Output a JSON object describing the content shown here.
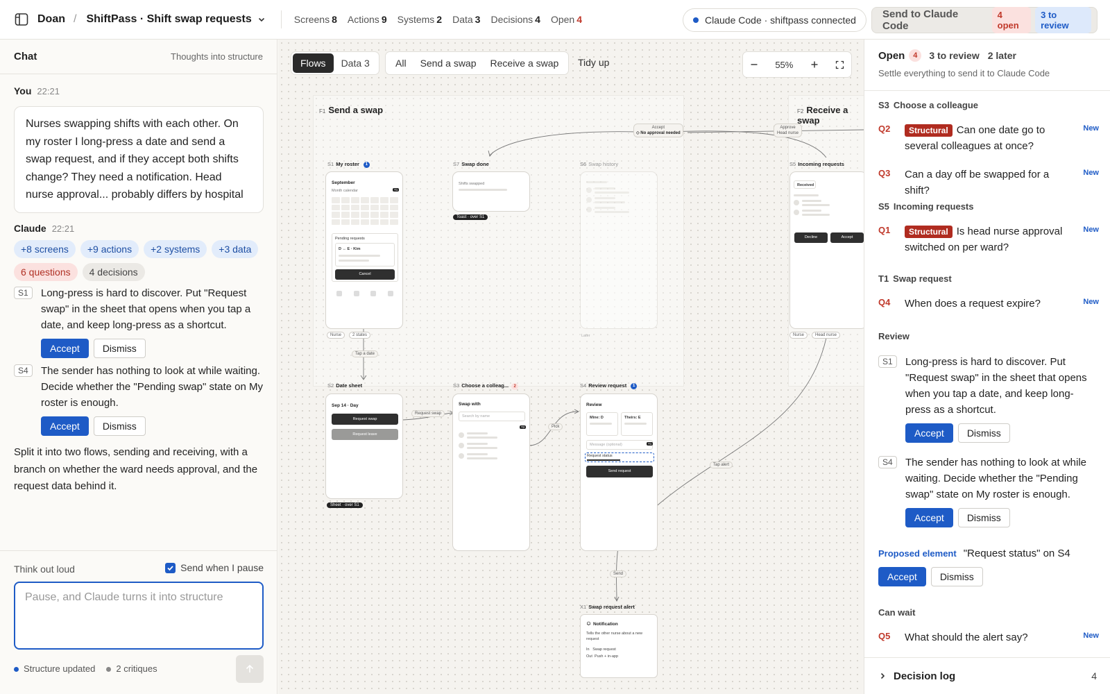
{
  "topbar": {
    "user": "Doan",
    "separator": "/",
    "project": "ShiftPass · Shift swap requests",
    "stats": [
      {
        "label": "Screens",
        "value": "8"
      },
      {
        "label": "Actions",
        "value": "9"
      },
      {
        "label": "Systems",
        "value": "2"
      },
      {
        "label": "Data",
        "value": "3"
      },
      {
        "label": "Decisions",
        "value": "4"
      },
      {
        "label": "Open",
        "value": "4"
      }
    ],
    "connection_status": "Claude Code · shiftpass connected",
    "send_button": {
      "label": "Send to Claude Code",
      "open": "4 open",
      "review": "3 to review"
    }
  },
  "chat": {
    "title": "Chat",
    "subtitle": "Thoughts into structure",
    "user_msg": {
      "who": "You",
      "time": "22:21",
      "text": "Nurses swapping shifts with each other. On my roster I long-press a date and send a swap request, and if they accept both shifts change? They need a notification. Head nurse approval... probably differs by hospital"
    },
    "claude_msg": {
      "who": "Claude",
      "time": "22:21",
      "chips_blue": [
        "+8 screens",
        "+9 actions",
        "+2 systems",
        "+3 data"
      ],
      "chip_questions": "6 questions",
      "chip_decisions": "4 decisions",
      "suggestions": [
        {
          "tag": "S1",
          "text": "Long-press is hard to discover. Put \"Request swap\" in the sheet that opens when you tap a date, and keep long-press as a shortcut.",
          "accept": "Accept",
          "dismiss": "Dismiss"
        },
        {
          "tag": "S4",
          "text": "The sender has nothing to look at while waiting. Decide whether the \"Pending swap\" state on My roster is enough.",
          "accept": "Accept",
          "dismiss": "Dismiss"
        }
      ],
      "closing": "Split it into two flows, sending and receiving, with a branch on whether the ward needs approval, and the request data behind it."
    },
    "composer": {
      "label": "Think out loud",
      "checkbox_label": "Send when I pause",
      "checkbox_checked": true,
      "placeholder": "Pause, and Claude turns it into structure",
      "value": "",
      "status_left": "Structure updated",
      "status_right": "2 critiques"
    }
  },
  "canvas": {
    "tabs": [
      {
        "label": "Flows",
        "active": true
      },
      {
        "label": "Data 3",
        "active": false
      }
    ],
    "filters": [
      "All",
      "Send a swap",
      "Receive a swap"
    ],
    "tidy_label": "Tidy up",
    "zoom": "55%",
    "flow1": {
      "key": "F1",
      "title": "Send a swap"
    },
    "flow2": {
      "key": "F2",
      "title": "Receive a swap"
    },
    "screens": {
      "s1": {
        "key": "S1",
        "name": "My roster",
        "badge": "1",
        "month": "September",
        "sub": "Month calendar",
        "pending": "Pending requests",
        "pending_item": "D ↔ E · Kim",
        "cancel": "Cancel",
        "mini": "T1",
        "tags": [
          "Nurse",
          "2 states"
        ]
      },
      "s7": {
        "key": "S7",
        "name": "Swap done",
        "line": "Shifts swapped",
        "tag": "Toast · over S1"
      },
      "s6": {
        "key": "S6",
        "name": "Swap history",
        "tag": "Later"
      },
      "s5": {
        "key": "S5",
        "name": "Incoming requests",
        "received": "Received",
        "decline": "Decline",
        "accept": "Accept",
        "tags": [
          "Nurse",
          "Head nurse"
        ]
      },
      "s2": {
        "key": "S2",
        "name": "Date sheet",
        "title": "Sep 14 · Day",
        "btn1": "Request swap",
        "btn2": "Request leave",
        "tag": "Sheet · over S1"
      },
      "s3": {
        "key": "S3",
        "name": "Choose a colleag...",
        "badge": "2",
        "title": "Swap with",
        "search": "Search by name",
        "mini": "T2"
      },
      "s4": {
        "key": "S4",
        "name": "Review request",
        "badge": "1",
        "title": "Review",
        "mine": "Mine: D",
        "theirs": "Theirs: E",
        "message": "Message (optional)",
        "status": "Request status",
        "mini": "T1",
        "send": "Send request"
      },
      "x1": {
        "key": "X1",
        "name": "Swap request alert",
        "title": "Notification",
        "desc": "Tells the other nurse about a new request",
        "in_k": "In",
        "in_v": "Swap request",
        "out_k": "Out",
        "out_v": "Push + in-app"
      }
    },
    "edges": {
      "tap_date": "Tap a date",
      "request_swap": "Request swap",
      "pick": "Pick",
      "send": "Send",
      "tap_alert": "Tap alert",
      "accept_top": "Accept",
      "no_approval": "◇ No approval needed",
      "approve": "Approve",
      "head_nurse": "Head nurse"
    }
  },
  "panel": {
    "open_label": "Open",
    "open_count": "4",
    "to_review": "3 to review",
    "later": "2 later",
    "subtitle": "Settle everything to send it to Claude Code",
    "sections": [
      {
        "key": "S3",
        "title": "Choose a colleague"
      },
      {
        "key": "S5",
        "title": "Incoming requests"
      },
      {
        "key": "T1",
        "title": "Swap request"
      }
    ],
    "questions": {
      "q2": {
        "id": "Q2",
        "structural": "Structural",
        "text": "Can one date go to several colleagues at once?",
        "new": "New"
      },
      "q3": {
        "id": "Q3",
        "text": "Can a day off be swapped for a shift?",
        "new": "New"
      },
      "q1": {
        "id": "Q1",
        "structural": "Structural",
        "text": "Is head nurse approval switched on per ward?",
        "new": "New"
      },
      "q4": {
        "id": "Q4",
        "text": "When does a request expire?",
        "new": "New"
      },
      "q5": {
        "id": "Q5",
        "text": "What should the alert say?",
        "new": "New"
      }
    },
    "review_title": "Review",
    "review": [
      {
        "tag": "S1",
        "text": "Long-press is hard to discover. Put \"Request swap\" in the sheet that opens when you tap a date, and keep long-press as a shortcut.",
        "accept": "Accept",
        "dismiss": "Dismiss"
      },
      {
        "tag": "S4",
        "text": "The sender has nothing to look at while waiting. Decide whether the \"Pending swap\" state on My roster is enough.",
        "accept": "Accept",
        "dismiss": "Dismiss"
      }
    ],
    "proposed": {
      "label": "Proposed element",
      "text": "\"Request status\" on S4",
      "accept": "Accept",
      "dismiss": "Dismiss"
    },
    "can_wait": "Can wait",
    "decision_log": {
      "label": "Decision log",
      "count": "4"
    }
  },
  "colors": {
    "accent": "#1e5bc6",
    "danger": "#c0392b",
    "structural": "#b02c20"
  }
}
